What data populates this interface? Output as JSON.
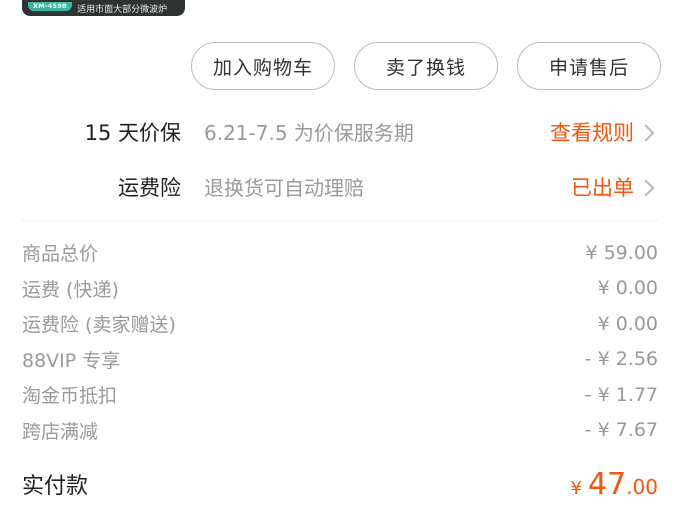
{
  "product": {
    "model": "XM-459B",
    "description": "适用市面大部分微波炉"
  },
  "actions": {
    "add_to_cart": "加入购物车",
    "sell_for_cash": "卖了换钱",
    "after_sales": "申请售后"
  },
  "services": {
    "price_protect": {
      "label": "15 天价保",
      "desc": "6.21-7.5 为价保服务期",
      "link": "查看规则"
    },
    "shipping_insurance": {
      "label": "运费险",
      "desc": "退换货可自动理赔",
      "link": "已出单"
    }
  },
  "breakdown": [
    {
      "label": "商品总价",
      "value": "¥ 59.00"
    },
    {
      "label": "运费 (快递)",
      "value": "¥ 0.00"
    },
    {
      "label": "运费险 (卖家赠送)",
      "value": "¥ 0.00"
    },
    {
      "label": "88VIP 专享",
      "value": "- ¥ 2.56"
    },
    {
      "label": "淘金币抵扣",
      "value": "- ¥ 1.77"
    },
    {
      "label": "跨店满减",
      "value": "- ¥ 7.67"
    }
  ],
  "total": {
    "label": "实付款",
    "currency": "¥",
    "integer": "47",
    "decimal": ".00"
  },
  "colors": {
    "accent": "#f2570b",
    "muted": "#9a9a9a",
    "text": "#222222",
    "button_border": "#bdbdbd"
  }
}
